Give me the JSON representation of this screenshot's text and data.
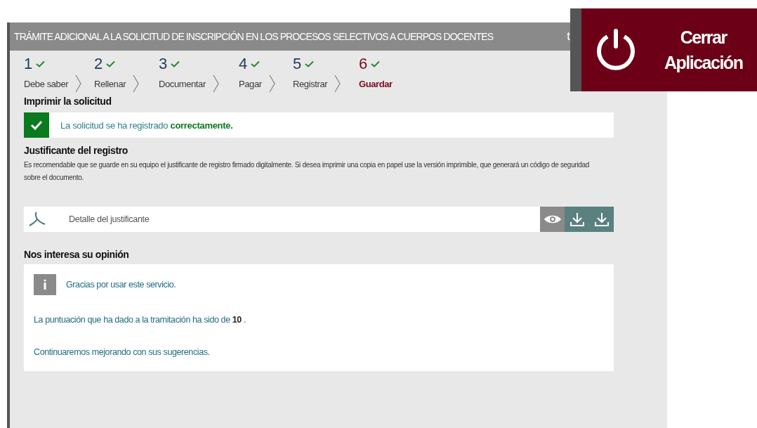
{
  "window": {
    "title": "TRÁMITE ADICIONAL A LA SOLICITUD DE INSCRIPCIÓN EN LOS PROCESOS SELECTIVOS A CUERPOS DOCENTES",
    "cut_text": "t"
  },
  "close_app": {
    "label_line_1": "Cerrar",
    "label_line_2": "Aplicación"
  },
  "steps": [
    {
      "number": "1",
      "label": "Debe saber",
      "done": true,
      "selected": false
    },
    {
      "number": "2",
      "label": "Rellenar",
      "done": true,
      "selected": false
    },
    {
      "number": "3",
      "label": "Documentar",
      "done": true,
      "selected": false
    },
    {
      "number": "4",
      "label": "Pagar",
      "done": true,
      "selected": false
    },
    {
      "number": "5",
      "label": "Registrar",
      "done": true,
      "selected": false
    },
    {
      "number": "6",
      "label": "Guardar",
      "done": true,
      "selected": true
    }
  ],
  "print_section": {
    "heading": "Imprimir la solicitud",
    "status": {
      "kind": "success",
      "message": "La solicitud se ha registrado **correctamente.**"
    }
  },
  "receipt": {
    "heading": "Justificante del registro",
    "description": "Es recomendable que se guarde en su equipo el justificante de registro firmado digitalmente. Si desea imprimir una copia en papel use la versión imprimible, que generará un código de seguridad sobre el documento.",
    "document": {
      "name": "Detalle del justificante"
    }
  },
  "opinion": {
    "heading": "Nos interesa su opinión",
    "thanks": "Gracias por usar este servicio.",
    "score": "La puntuación que ha dado a la tramitación ha sido de **10** .",
    "closing": "Continuaremos mejorando con sus sugerencias."
  }
}
